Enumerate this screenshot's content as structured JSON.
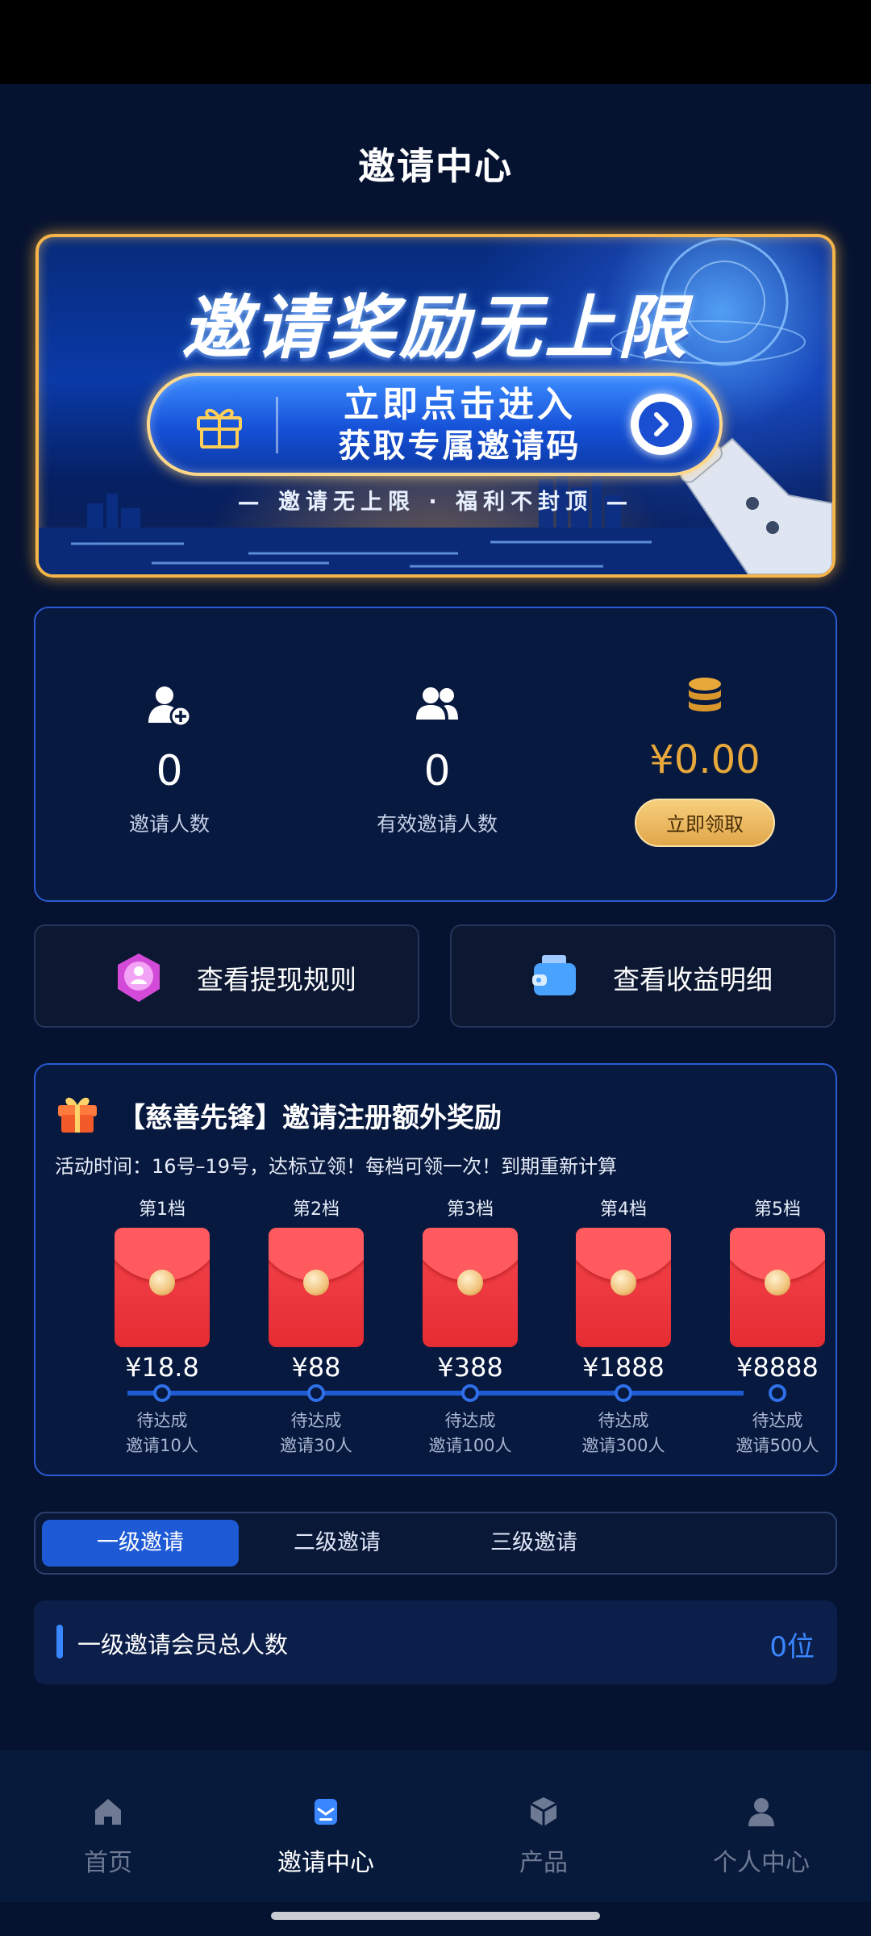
{
  "page": {
    "title": "邀请中心"
  },
  "banner": {
    "headline": "邀请奖励无上限",
    "cta_line1": "立即点击进入",
    "cta_line2": "获取专属邀请码",
    "tagline": "— 邀请无上限 · 福利不封顶 —"
  },
  "stats": {
    "invites": {
      "value": "0",
      "label": "邀请人数"
    },
    "valid_invites": {
      "value": "0",
      "label": "有效邀请人数"
    },
    "earnings": {
      "value": "¥0.00",
      "button": "立即领取"
    }
  },
  "actions": {
    "withdraw_rules": "查看提现规则",
    "earnings_detail": "查看收益明细"
  },
  "reward": {
    "title": "【慈善先锋】邀请注册额外奖励",
    "subtitle": "活动时间：16号–19号，达标立领！每档可领一次！到期重新计算",
    "tiers": [
      {
        "name": "第1档",
        "amount": "¥18.8",
        "status": "待达成",
        "requirement": "邀请10人"
      },
      {
        "name": "第2档",
        "amount": "¥88",
        "status": "待达成",
        "requirement": "邀请30人"
      },
      {
        "name": "第3档",
        "amount": "¥388",
        "status": "待达成",
        "requirement": "邀请100人"
      },
      {
        "name": "第4档",
        "amount": "¥1888",
        "status": "待达成",
        "requirement": "邀请300人"
      },
      {
        "name": "第5档",
        "amount": "¥8888",
        "status": "待达成",
        "requirement": "邀请500人"
      }
    ]
  },
  "tabs": [
    {
      "label": "一级邀请",
      "active": true
    },
    {
      "label": "二级邀请",
      "active": false
    },
    {
      "label": "三级邀请",
      "active": false
    }
  ],
  "summary": {
    "label": "一级邀请会员总人数",
    "value": "0位"
  },
  "nav": [
    {
      "label": "首页",
      "icon": "home-icon",
      "active": false
    },
    {
      "label": "邀请中心",
      "icon": "invite-icon",
      "active": true
    },
    {
      "label": "产品",
      "icon": "product-cube-icon",
      "active": false
    },
    {
      "label": "个人中心",
      "icon": "user-icon",
      "active": false
    }
  ],
  "colors": {
    "accent": "#1f5ad6",
    "gold": "#e9a93a",
    "background": "#061330"
  }
}
